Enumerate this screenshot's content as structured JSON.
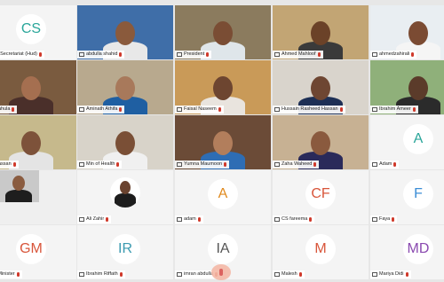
{
  "meeting": {
    "tiles": [
      {
        "name": "et Secretariat (Hud)",
        "initials": "CS",
        "color": "#2aa69a",
        "video": false,
        "bg": "#f4f4f4"
      },
      {
        "name": "abdulla shahid",
        "initials": "",
        "video": true,
        "bg": "#3f6ea8",
        "skin": "#8a5a3c",
        "shirt": "#e8e8e8"
      },
      {
        "name": "President",
        "initials": "",
        "video": true,
        "bg": "#8b7b5e",
        "skin": "#7a4d34",
        "shirt": "#dfe6ea"
      },
      {
        "name": "Ahmed Mahloof",
        "initials": "",
        "video": true,
        "bg": "#c2a574",
        "skin": "#6b4228",
        "shirt": "#3a3a3a"
      },
      {
        "name": "ahmedzahirali",
        "initials": "",
        "video": true,
        "bg": "#e9eef2",
        "skin": "#7b4b33",
        "shirt": "#f5f5f5"
      },
      {
        "name": "Nahula",
        "initials": "",
        "video": true,
        "bg": "#7a5b3f",
        "skin": "#a56f50",
        "shirt": "#4a2f2a"
      },
      {
        "name": "Aminath Athifa",
        "initials": "",
        "video": true,
        "bg": "#b8a98e",
        "skin": "#a8795b",
        "shirt": "#1f5fa2"
      },
      {
        "name": "Faisal Naseem",
        "initials": "",
        "video": true,
        "bg": "#c99a58",
        "skin": "#6d4530",
        "shirt": "#e9e4de"
      },
      {
        "name": "Hussain Rasheed Hassan",
        "initials": "",
        "video": true,
        "bg": "#d9d4cc",
        "skin": "#6e4632",
        "shirt": "#1d2f55"
      },
      {
        "name": "Ibrahim Ameer",
        "initials": "",
        "video": true,
        "bg": "#8fb07a",
        "skin": "#5b3b2a",
        "shirt": "#2b2b2b"
      },
      {
        "name": "Hassan",
        "initials": "",
        "video": true,
        "bg": "#c6b98c",
        "skin": "#7d523a",
        "shirt": "#e4e4e4"
      },
      {
        "name": "Min of Health",
        "initials": "",
        "video": true,
        "bg": "#d8d3c9",
        "skin": "#7a4f36",
        "shirt": "#f0f0f0"
      },
      {
        "name": "Yumna Maumoon",
        "initials": "",
        "video": true,
        "bg": "#6b4b37",
        "skin": "#b27e5c",
        "shirt": "#2e6db4"
      },
      {
        "name": "Zaha Waheed",
        "initials": "",
        "video": true,
        "bg": "#c7b193",
        "skin": "#8a5a3e",
        "shirt": "#2a2a5a"
      },
      {
        "name": "Adam",
        "initials": "A",
        "color": "#2aa69a",
        "video": false,
        "bg": "#f4f4f4"
      },
      {
        "name": "",
        "initials": "",
        "video": true,
        "bg": "#c9c9c9",
        "skin": "#8a5c40",
        "shirt": "#1e1e1e",
        "small": true
      },
      {
        "name": "Ali Zahir",
        "initials": "",
        "video": false,
        "bg": "#f4f4f4",
        "photo": true
      },
      {
        "name": "adam",
        "initials": "A",
        "color": "#e08a1e",
        "video": false,
        "bg": "#f4f4f4"
      },
      {
        "name": "CS fareema",
        "initials": "CF",
        "color": "#d8553a",
        "video": false,
        "bg": "#f4f4f4"
      },
      {
        "name": "Faya",
        "initials": "F",
        "color": "#3b8ed6",
        "video": false,
        "bg": "#f4f4f4"
      },
      {
        "name": "r Minister",
        "initials": "GM",
        "color": "#d8553a",
        "video": false,
        "bg": "#f4f4f4"
      },
      {
        "name": "Ibrahim Riffath",
        "initials": "IR",
        "color": "#3b9ab0",
        "video": false,
        "bg": "#f4f4f4"
      },
      {
        "name": "imran abdulla",
        "initials": "IA",
        "color": "#555555",
        "video": false,
        "bg": "#f4f4f4"
      },
      {
        "name": "Malesh",
        "initials": "M",
        "color": "#d8553a",
        "video": false,
        "bg": "#f4f4f4"
      },
      {
        "name": "Mariya Didi",
        "initials": "MD",
        "color": "#8a4ab0",
        "video": false,
        "bg": "#f4f4f4"
      }
    ]
  }
}
